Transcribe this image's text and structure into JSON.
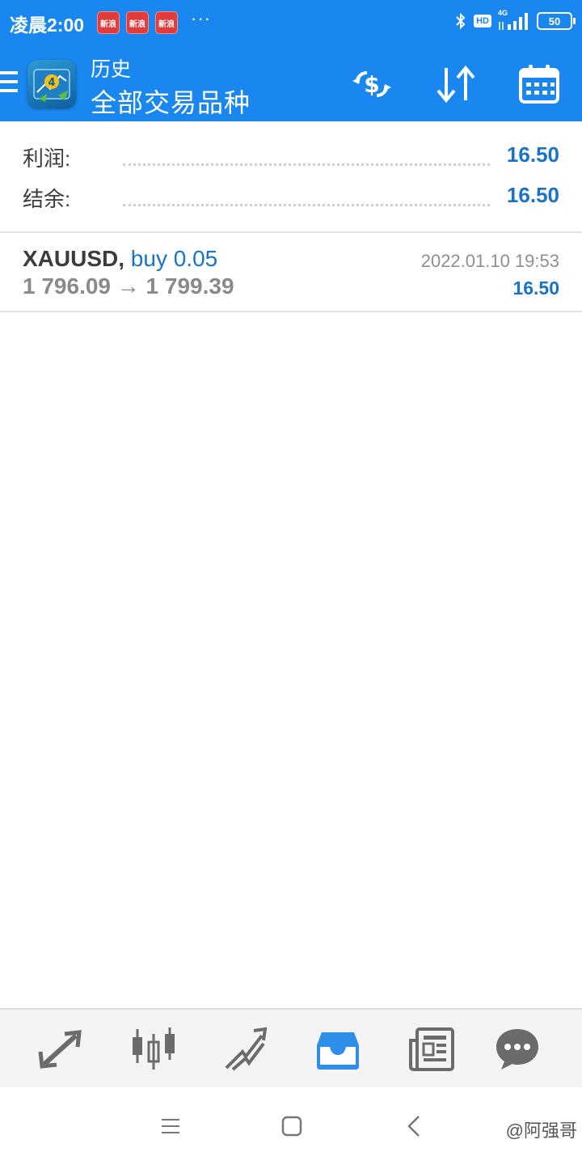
{
  "status_bar": {
    "time": "凌晨2:00",
    "badges": [
      "新浪",
      "新浪",
      "新浪"
    ],
    "more": "···",
    "hd": "HD",
    "network": "4G",
    "battery": "50"
  },
  "header": {
    "title": "历史",
    "subtitle": "全部交易品种"
  },
  "summary": {
    "profit_label": "利润:",
    "profit_value": "16.50",
    "balance_label": "结余:",
    "balance_value": "16.50"
  },
  "deals": [
    {
      "symbol": "XAUUSD,",
      "type": "buy 0.05",
      "prices": "1 796.09 → 1 799.39",
      "time": "2022.01.10 19:53",
      "profit": "16.50"
    }
  ],
  "colors": {
    "accent": "#1a86ef",
    "value_blue": "#1a73c8",
    "active_tab": "#2f8fe8",
    "tab_icon": "#6b6b6b"
  },
  "tabs": [
    "quotes-icon",
    "chart-icon",
    "trade-icon",
    "history-icon",
    "news-icon",
    "chat-icon"
  ],
  "watermark": "@阿强哥"
}
